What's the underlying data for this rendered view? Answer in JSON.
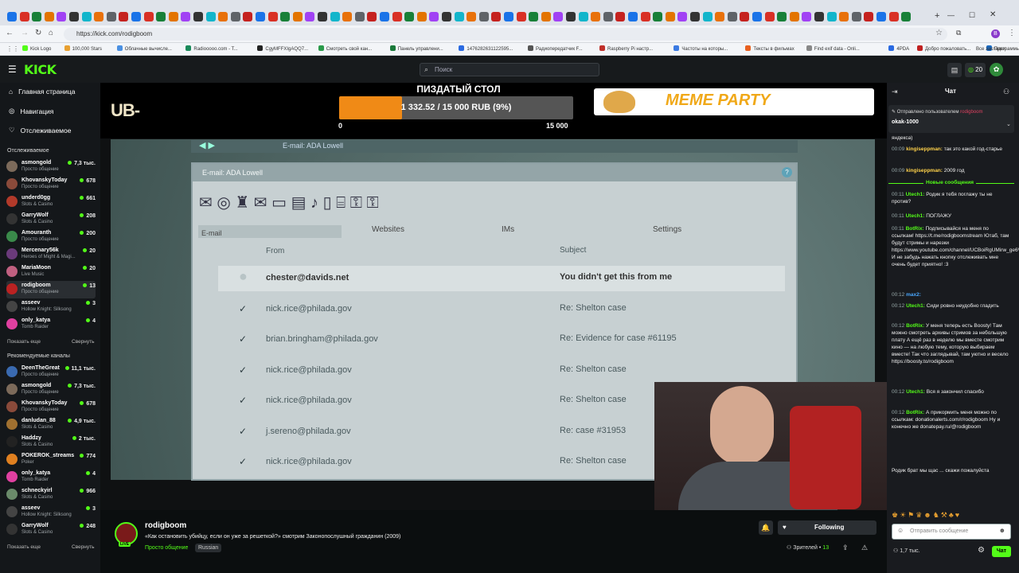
{
  "browser": {
    "url": "https://kick.com/rodigboom",
    "bookmarks": [
      "Kick Logo",
      "100,000 Stars",
      "Облачные вычисле...",
      "Radiooooo.com - T...",
      "CgyMFFXIgAQQ7...",
      "Смотреть свой кан...",
      "Панель управлени...",
      "1476282631122595...",
      "Радиопередатчик F...",
      "Raspberry Pi настр...",
      "Частоты на которы...",
      "Тексты в фильмах",
      "Find exif data - Onli...",
      "4PDA",
      "Добро пожаловать...",
      "Программы компа..."
    ],
    "all_bookmarks": "Все закладки"
  },
  "header": {
    "logo": "KICK",
    "search_placeholder": "Поиск",
    "points": "20"
  },
  "sidebar": {
    "nav": [
      "Главная страница",
      "Навигация",
      "Отслеживаемое"
    ],
    "followed_title": "Отслеживаемое",
    "followed": [
      {
        "name": "asmongold",
        "cat": "Просто общение",
        "viewers": "7,3 тыс.",
        "color": "#7c6a5a"
      },
      {
        "name": "KhovanskyToday",
        "cat": "Просто общение",
        "viewers": "678",
        "color": "#8a4a3a"
      },
      {
        "name": "underd0gg",
        "cat": "Slots & Casino",
        "viewers": "661",
        "color": "#b23a2a"
      },
      {
        "name": "GarryWolf",
        "cat": "Slots & Casino",
        "viewers": "208",
        "color": "#333"
      },
      {
        "name": "Amouranth",
        "cat": "Просто общение",
        "viewers": "200",
        "color": "#3a8a4a"
      },
      {
        "name": "Mercenary56k",
        "cat": "Heroes of Might & Magi...",
        "viewers": "20",
        "color": "#6a3a7a"
      },
      {
        "name": "MariaMoon",
        "cat": "Live Music",
        "viewers": "20",
        "color": "#c06080"
      },
      {
        "name": "rodigboom",
        "cat": "Просто общение",
        "viewers": "13",
        "color": "#b22",
        "selected": true
      },
      {
        "name": "asseev",
        "cat": "Hollow Knight: Silksong",
        "viewers": "3",
        "color": "#444"
      },
      {
        "name": "only_katya",
        "cat": "Tomb Raider",
        "viewers": "4",
        "color": "#e040a0"
      }
    ],
    "show_more": "Показать еще",
    "collapse": "Свернуть",
    "recommended_title": "Рекомендуемые каналы",
    "recommended": [
      {
        "name": "DeenTheGreat",
        "cat": "Просто общение",
        "viewers": "11,1 тыс.",
        "color": "#3a6ab0"
      },
      {
        "name": "asmongold",
        "cat": "Просто общение",
        "viewers": "7,3 тыс.",
        "color": "#7c6a5a"
      },
      {
        "name": "KhovanskyToday",
        "cat": "Просто общение",
        "viewers": "678",
        "color": "#8a4a3a"
      },
      {
        "name": "danludan_88",
        "cat": "Slots & Casino",
        "viewers": "4,9 тыс.",
        "color": "#a07030"
      },
      {
        "name": "Haddzy",
        "cat": "Slots & Casino",
        "viewers": "2 тыс.",
        "color": "#222"
      },
      {
        "name": "POKEROK_streams",
        "cat": "Poker",
        "viewers": "774",
        "color": "#e08020"
      },
      {
        "name": "only_katya",
        "cat": "Tomb Raider",
        "viewers": "4",
        "color": "#e040a0"
      },
      {
        "name": "schneckyirl",
        "cat": "Slots & Casino",
        "viewers": "966",
        "color": "#6a8a6a"
      },
      {
        "name": "asseev",
        "cat": "Hollow Knight: Silksong",
        "viewers": "3",
        "color": "#444"
      },
      {
        "name": "GarryWolf",
        "cat": "Slots & Casino",
        "viewers": "248",
        "color": "#333"
      }
    ]
  },
  "overlay": {
    "left_text": "UB-",
    "goal_title": "ПИЗДАТЫЙ СТОЛ",
    "goal_text": "1 332.52 / 15 000 RUB (9%)",
    "goal_fraction": 0.09,
    "goal_min": "0",
    "goal_max": "15 000",
    "banner": "MEME PARTY"
  },
  "email_window": {
    "address_bar": "E-mail: ADA Lowell",
    "title": "E-mail: ADA Lowell",
    "tabs": [
      "E-mail",
      "Websites",
      "IMs",
      "Settings"
    ],
    "col_from": "From",
    "col_subject": "Subject",
    "rows": [
      {
        "from": "chester@davids.net",
        "subject": "You didn't get this from me",
        "read": false
      },
      {
        "from": "nick.rice@philada.gov",
        "subject": "Re: Shelton case",
        "read": true
      },
      {
        "from": "brian.bringham@philada.gov",
        "subject": "Re: Evidence for case #61195",
        "read": true
      },
      {
        "from": "nick.rice@philada.gov",
        "subject": "Re: Shelton case",
        "read": true
      },
      {
        "from": "nick.rice@philada.gov",
        "subject": "Re: Shelton case",
        "read": true
      },
      {
        "from": "j.sereno@philada.gov",
        "subject": "Re: case #31953",
        "read": true
      },
      {
        "from": "nick.rice@philada.gov",
        "subject": "Re: Shelton case",
        "read": true
      }
    ]
  },
  "stream_info": {
    "channel": "rodigboom",
    "title": "«Как остановить убийцу, если он уже за решеткой?» смотрим Законопослушный гражданин (2009)",
    "category": "Просто общение",
    "tag": "Russian",
    "follow_label": "Following",
    "viewers_label": "Зрителей",
    "viewers": "13"
  },
  "chat": {
    "title": "Чат",
    "pinned_by": "Отправлено пользователем",
    "pinned_user": "rodigboom",
    "pinned_text": "okak-1000",
    "new_messages": "Новые сообщения",
    "messages": [
      {
        "time": "",
        "user": "",
        "text": "яндекса)",
        "ucolor": "#fff"
      },
      {
        "time": "00:09",
        "user": "kingiseppman:",
        "text": "так это какой год-старье",
        "ucolor": "#ffd24a"
      },
      {
        "time": "00:09",
        "user": "kingiseppman:",
        "text": "2009 год",
        "ucolor": "#ffd24a"
      },
      {
        "time": "00:11",
        "user": "Utech1:",
        "text": "Родик я тебя поглажу ты не против?",
        "ucolor": "#53fc18"
      },
      {
        "time": "00:11",
        "user": "Utech1:",
        "text": "ПОГЛАЖУ",
        "ucolor": "#53fc18"
      },
      {
        "time": "00:11",
        "user": "BotRix:",
        "text": "Подписывайся на меня по ссылкам! https://t.me/rodigboomstream Ютаб, там будут стримы и нарезки https://www.youtube.com/channel/UCBoiRgUMirw_ge6Vt_BbWQ И не забудь нажать кнопку отслеживать мне очень будет приятно! :3",
        "ucolor": "#53fc18"
      },
      {
        "time": "00:12",
        "user": "max2:",
        "text": "",
        "ucolor": "#4aa8ff"
      },
      {
        "time": "00:12",
        "user": "Utech1:",
        "text": "Сиди ровно неудобно гладить",
        "ucolor": "#53fc18"
      },
      {
        "time": "00:12",
        "user": "BotRix:",
        "text": "У меня теперь есть Boosty! Там можно смотреть архивы стримов за небольшую плату А ещё раз в неделю мы вместе смотрим кино — на любую тему, которую выбираем вместе! Так что заглядывай, там уютно и весело https://boosty.to/rodigboom",
        "ucolor": "#53fc18"
      },
      {
        "time": "00:12",
        "user": "Utech1:",
        "text": "Вся я закончил спасибо",
        "ucolor": "#53fc18"
      },
      {
        "time": "00:12",
        "user": "BotRix:",
        "text": "А прикормить меня можно по ссылкам: donationalerts.com/r/rodigboom Ну и конечно же donatepay.ru/@rodigboom",
        "ucolor": "#53fc18"
      },
      {
        "time": "",
        "user": "",
        "text": "Родик брат мы щас ... скажи пожалуйста",
        "ucolor": "#fff"
      }
    ],
    "input_placeholder": "Отправить сообщение",
    "points": "1,7 тыс.",
    "send_label": "Чат"
  }
}
